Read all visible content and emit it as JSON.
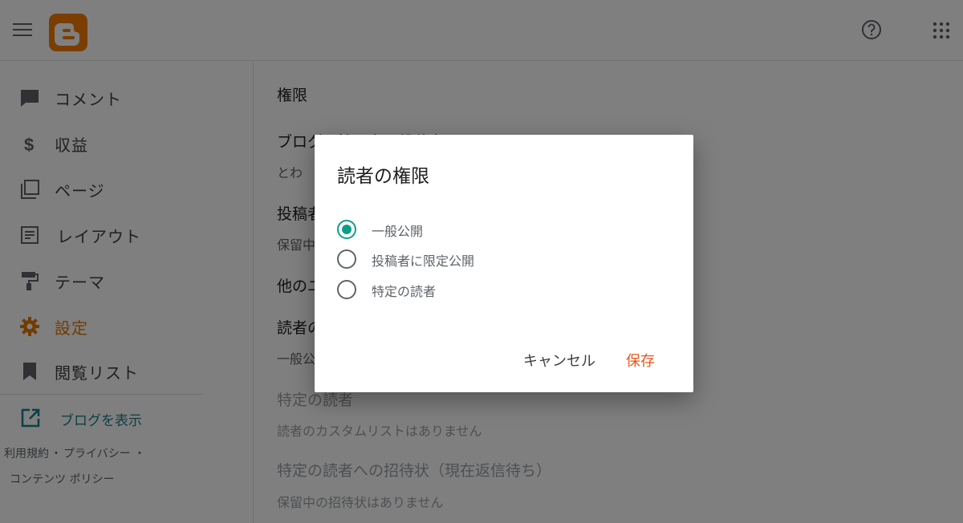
{
  "topbar": {
    "menu_icon": "hamburger-menu-icon",
    "logo_icon": "blogger-logo-icon",
    "help_icon": "help-circle-icon",
    "apps_icon": "apps-grid-icon"
  },
  "sidebar": {
    "items": [
      {
        "label": "コメント",
        "icon": "comment-icon"
      },
      {
        "label": "収益",
        "icon": "dollar-icon"
      },
      {
        "label": "ページ",
        "icon": "pages-icon"
      },
      {
        "label": "レイアウト",
        "icon": "layout-icon"
      },
      {
        "label": "テーマ",
        "icon": "paint-roller-icon"
      },
      {
        "label": "設定",
        "icon": "gear-icon",
        "active": true
      },
      {
        "label": "閲覧リスト",
        "icon": "bookmark-icon"
      }
    ],
    "view_blog": "ブログを表示",
    "footer": {
      "terms": "利用規約",
      "sep1": "・",
      "privacy": "プライバシー",
      "sep2": "・",
      "content_policy": "コンテンツ ポリシー"
    }
  },
  "main": {
    "section_title": "権限",
    "blog_admins_heading": "ブログの管理者と投稿者",
    "blog_admins_value": "とわ",
    "pending_authors_heading": "投稿者",
    "pending_authors_value": "保留中",
    "other_heading": "他のユ",
    "reader_access_heading": "読者の",
    "reader_access_value": "一般公",
    "specific_readers_heading": "特定の読者",
    "specific_readers_value": "読者のカスタムリストはありません",
    "invites_heading": "特定の読者への招待状（現在返信待ち）",
    "invites_value": "保留中の招待状はありません"
  },
  "dialog": {
    "title": "読者の権限",
    "options": [
      {
        "label": "一般公開",
        "checked": true
      },
      {
        "label": "投稿者に限定公開",
        "checked": false
      },
      {
        "label": "特定の読者",
        "checked": false
      }
    ],
    "cancel_label": "キャンセル",
    "save_label": "保存"
  },
  "colors": {
    "accent": "#e67700",
    "save": "#e8571a",
    "radio_checked": "#0f9d8a",
    "link": "#1b7f8a"
  }
}
